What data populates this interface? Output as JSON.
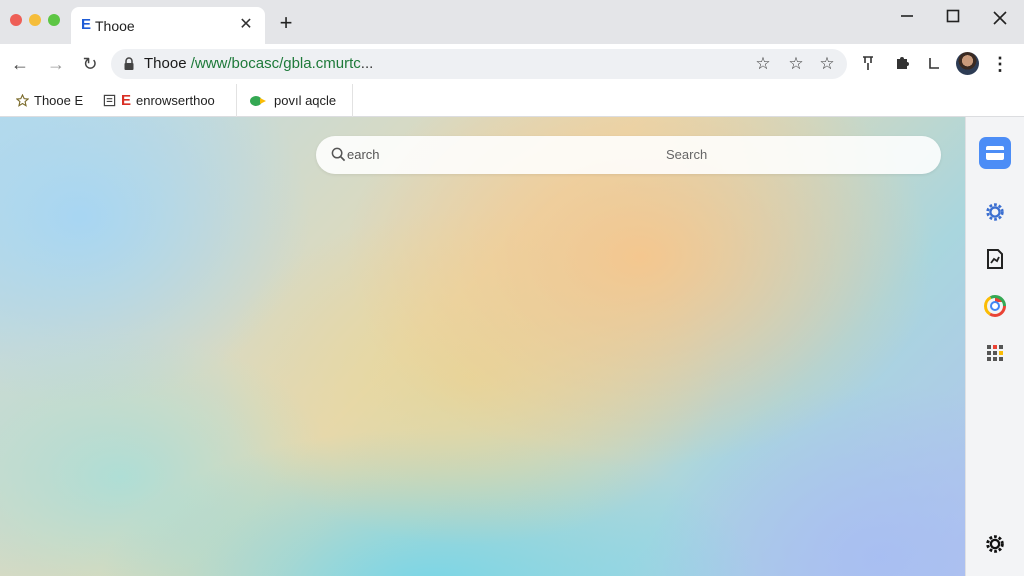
{
  "window": {
    "tabs": [
      {
        "favicon": "E",
        "title": "Thooe",
        "close": "✕"
      }
    ],
    "new_tab": "+",
    "controls": {
      "minimize": "—",
      "maximize": "☐",
      "close": "✕"
    }
  },
  "toolbar": {
    "back": "←",
    "forward": "→",
    "reload": "↻",
    "address": {
      "host": "Thooe",
      "path": "/www/bocasc/gbla.cmurtc",
      "rest": "..."
    },
    "star_icons": [
      "star-outline-icon",
      "star-outline-icon",
      "star-outline-icon"
    ],
    "extensions": [
      "pin-icon",
      "puzzle-icon",
      "download-icon"
    ],
    "menu": "⋮"
  },
  "bookmarks": [
    {
      "icon": "star-icon",
      "label": "Thooe E"
    },
    {
      "icon": "document-icon",
      "badge": "E",
      "label": "enrowserthoo"
    },
    {
      "icon": "leaf-icon",
      "label": "povıl aqcle"
    }
  ],
  "search": {
    "placeholder": "earch",
    "button_label": "Search"
  },
  "side_panel": {
    "accent_color": "#4c8df6",
    "items": [
      "card-icon",
      "gear-icon",
      "document-chart-icon",
      "chrome-icon",
      "apps-grid-icon",
      "settings-icon"
    ]
  }
}
